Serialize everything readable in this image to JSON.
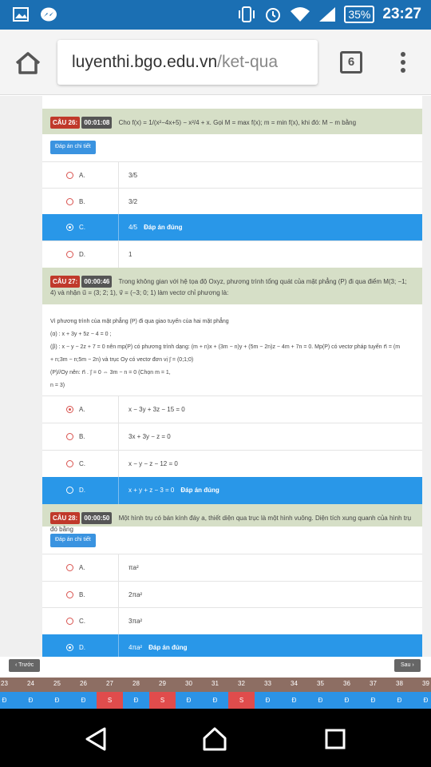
{
  "status_bar": {
    "battery": "35%",
    "time": "23:27"
  },
  "browser": {
    "url_domain": "luyenthi.bgo.edu.vn",
    "url_path": "/ket-qua",
    "tab_count": "6"
  },
  "q26": {
    "number": "CÂU 26:",
    "time": "00:01:08",
    "text": "Cho f(x) = 1/(x²−4x+5) − x²/4 + x. Gọi M = max f(x); m = min f(x), khi đó: M − m bằng",
    "detail_button": "Đáp án chi tiết",
    "options": [
      {
        "letter": "A.",
        "value": "3/5",
        "selected": false,
        "correct": false
      },
      {
        "letter": "B.",
        "value": "3/2",
        "selected": false,
        "correct": false
      },
      {
        "letter": "C.",
        "value": "4/5",
        "selected": true,
        "correct": true
      },
      {
        "letter": "D.",
        "value": "1",
        "selected": false,
        "correct": false
      }
    ],
    "correct_label": "Đáp án đúng"
  },
  "q27": {
    "number": "CÂU 27:",
    "time": "00:00:46",
    "text": "Trong không gian với hệ tọa độ Oxyz, phương trình tổng quát của mặt phẳng (P) đi qua điểm M(3; −1; 4) và nhận u⃗ = (3; 2; 1), v⃗ = (−3; 0; 1) làm vectơ chỉ phương là:",
    "explanation": [
      "Vì phương trình của mặt phẳng (P) đi qua giao tuyến của hai mặt phẳng",
      "(α) : x + 3y + 5z − 4 = 0 ;",
      "(β) : x − y − 2z + 7 = 0 nên mp(P) có phương trình dạng: (m + n)x + (3m − n)y + (5m − 2n)z − 4m + 7n = 0. Mp(P) có vectơ pháp tuyến n⃗ = (m",
      "+ n;3m − n;5m − 2n) và trục Oy có vectơ đơn vị j⃗ = (0;1;0)",
      "(P)//Oy nên: n⃗ . j⃗ = 0 ⇔ 3m − n = 0 (Chọn m = 1,",
      "n = 3)"
    ],
    "options": [
      {
        "letter": "A.",
        "value": "x − 3y + 3z − 15 = 0",
        "selected": true,
        "correct": false
      },
      {
        "letter": "B.",
        "value": "3x + 3y − z = 0",
        "selected": false,
        "correct": false
      },
      {
        "letter": "C.",
        "value": "x − y − z − 12 = 0",
        "selected": false,
        "correct": false
      },
      {
        "letter": "D.",
        "value": "x + y + z − 3 = 0",
        "selected": false,
        "correct": true
      }
    ],
    "correct_label": "Đáp án đúng"
  },
  "q28": {
    "number": "CÂU 28:",
    "time": "00:00:50",
    "text": "Một hình trụ có bán kính đáy a, thiết diện qua trục là một hình vuông. Diện tích xung quanh của hình trụ đó bằng",
    "detail_button": "Đáp án chi tiết",
    "options": [
      {
        "letter": "A.",
        "value": "πa²",
        "selected": false,
        "correct": false
      },
      {
        "letter": "B.",
        "value": "2πa²",
        "selected": false,
        "correct": false
      },
      {
        "letter": "C.",
        "value": "3πa²",
        "selected": false,
        "correct": false
      },
      {
        "letter": "D.",
        "value": "4πa²",
        "selected": true,
        "correct": true
      }
    ],
    "correct_label": "Đáp án đúng"
  },
  "pager": {
    "prev_label": "Trước",
    "next_label": "Sau"
  },
  "question_nav": {
    "numbers": [
      "23",
      "24",
      "25",
      "26",
      "27",
      "28",
      "29",
      "30",
      "31",
      "32",
      "33",
      "34",
      "35",
      "36",
      "37",
      "38",
      "39"
    ],
    "results": [
      "Đ",
      "Đ",
      "Đ",
      "Đ",
      "S",
      "Đ",
      "S",
      "Đ",
      "Đ",
      "S",
      "Đ",
      "Đ",
      "Đ",
      "Đ",
      "Đ",
      "Đ",
      "Đ"
    ]
  },
  "colors": {
    "header_blue": "#1b6fb3",
    "question_bg": "#d6dfc7",
    "correct_blue": "#2997e8",
    "wrong_red": "#e04c4c",
    "number_strip": "#8d6e63"
  }
}
